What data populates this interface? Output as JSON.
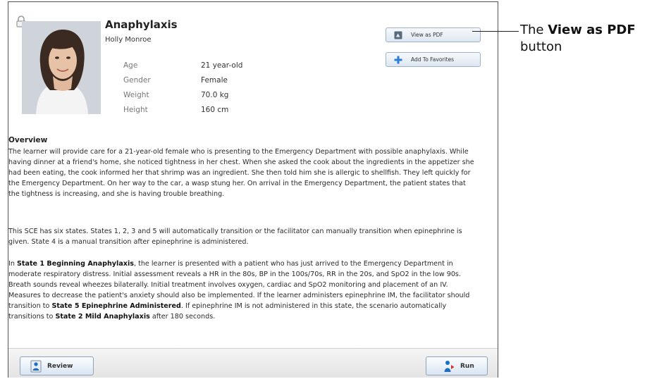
{
  "case": {
    "title": "Anaphylaxis",
    "patient_name": "Holly Monroe"
  },
  "stats": [
    {
      "label": "Age",
      "value": "21 year-old"
    },
    {
      "label": "Gender",
      "value": "Female"
    },
    {
      "label": "Weight",
      "value": "70.0 kg"
    },
    {
      "label": "Height",
      "value": "160 cm"
    }
  ],
  "buttons": {
    "view_pdf": "View as PDF",
    "add_favorites": "Add To Favorites",
    "review": "Review",
    "run": "Run"
  },
  "overview": {
    "heading": "Overview",
    "p1": "The learner will provide care for a 21-year-old female who is presenting to the Emergency Department with possible anaphylaxis. While having dinner at a friend's home, she noticed tightness in her chest. When she asked the cook about the ingredients in the appetizer she had been eating, the cook informed her that shrimp was an ingredient. She then told him she is allergic to shellfish. They left quickly for the Emergency Department. On her way to the car, a wasp stung her. On arrival in the Emergency Department, the patient states that the tightness is increasing, and she is having trouble breathing.",
    "p2": "This SCE has six states. States 1, 2, 3 and 5 will automatically transition or the facilitator can manually transition when epinephrine is given. State 4 is a manual transition after epinephrine is administered.",
    "p3": {
      "t1": "In ",
      "b1": "State 1 Beginning Anaphylaxis",
      "t2": ", the learner is presented with a patient who has just arrived to the Emergency Department in moderate respiratory distress. Initial assessment reveals a HR in the 80s, BP in the 100s/70s, RR in the 20s, and SpO2 in the low 90s. Breath sounds reveal wheezes bilaterally. Initial treatment involves oxygen, cardiac and SpO2 monitoring and placement of an IV. Measures to decrease the patient's anxiety should also be implemented. If the learner administers epinephrine IM, the facilitator should transition to ",
      "b2": "State 5 Epinephrine Administered",
      "t3": ". If epinephrine IM is not administered in this state, the scenario automatically transitions to ",
      "b3": "State 2 Mild Anaphylaxis",
      "t4": " after 180 seconds."
    }
  },
  "callout": {
    "prefix": "The ",
    "bold": "View as PDF",
    "suffix": " button"
  },
  "icons": {
    "lock": "lock-icon",
    "pdf": "pdf-icon",
    "add": "plus-icon",
    "review": "review-icon",
    "run": "run-icon"
  },
  "colors": {
    "plus": "#2a7fd4",
    "button_border": "#9fb2c8"
  }
}
